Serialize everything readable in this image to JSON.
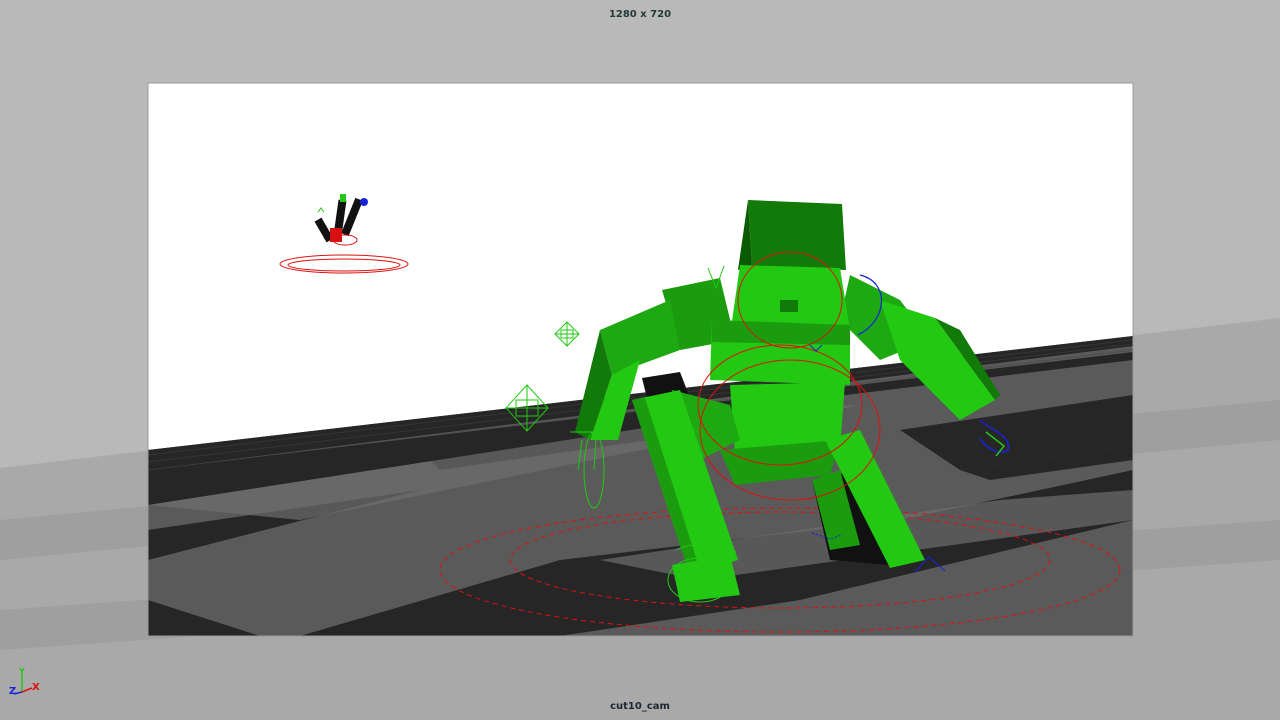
{
  "hud": {
    "resolution": "1280 x 720",
    "camera": "cut10_cam"
  },
  "axis_indicator": {
    "x_label": "X",
    "y_label": "Y",
    "z_label": "Z"
  },
  "colors": {
    "viewport_bg": "#b4b4b4",
    "sky": "#ffffff",
    "floor_dark": "#262626",
    "floor_light": "#5e5e5e",
    "character_green": "#22c812",
    "character_dark": "#0e7a06",
    "control_red": "#e01010",
    "control_blue": "#1a22d8"
  }
}
